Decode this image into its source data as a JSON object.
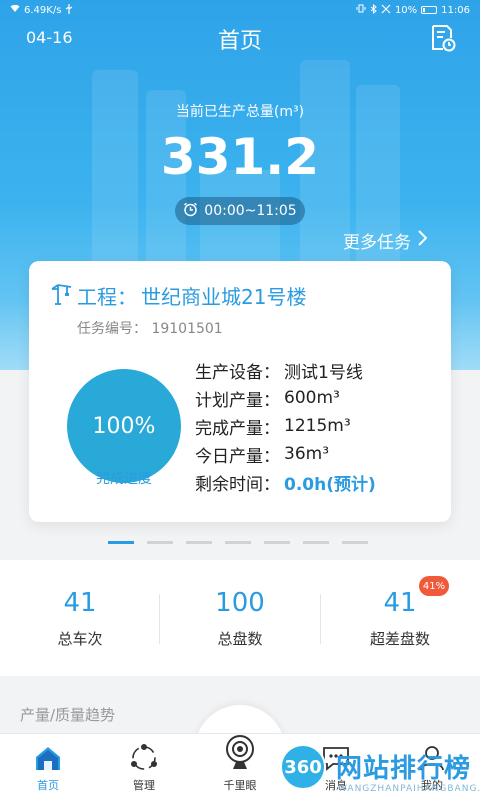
{
  "status_bar": {
    "network_speed": "6.49K/s",
    "battery": "10%",
    "time": "11:06"
  },
  "header": {
    "date": "04-16",
    "title": "首页",
    "doc_icon": "document-clock-icon"
  },
  "production": {
    "total_label": "当前已生产总量(m³)",
    "total_value": "331.2",
    "time_range": "00:00~11:05",
    "more_tasks": "更多任务"
  },
  "task_card": {
    "project_label": "工程：",
    "project_name": "世纪商业城21号楼",
    "task_no_label": "任务编号：",
    "task_no": "19101501",
    "progress": "100%",
    "progress_fraction": 1.0,
    "progress_label": "完成进度",
    "rows": [
      {
        "label": "生产设备：",
        "value": "测试1号线"
      },
      {
        "label": "计划产量：",
        "value": "600m³"
      },
      {
        "label": "完成产量：",
        "value": "1215m³"
      },
      {
        "label": "今日产量：",
        "value": "36m³"
      },
      {
        "label": "剩余时间：",
        "value": "0.0h(预计)"
      }
    ]
  },
  "carousel": {
    "page_count": 7,
    "active_index": 0
  },
  "stats": [
    {
      "value": "41",
      "label": "总车次"
    },
    {
      "value": "100",
      "label": "总盘数"
    },
    {
      "value": "41",
      "label": "超差盘数",
      "badge": "41%"
    }
  ],
  "trend_header": "产量/质量趋势",
  "tabs": [
    {
      "label": "首页",
      "icon": "home-icon"
    },
    {
      "label": "管理",
      "icon": "manage-icon"
    },
    {
      "label": "千里眼",
      "icon": "camera-icon"
    },
    {
      "label": "消息",
      "icon": "message-icon"
    },
    {
      "label": "我的",
      "icon": "user-icon"
    }
  ],
  "watermark": {
    "badge": "360",
    "text": "网站排行榜",
    "sub": "WANGZHANPAIHANGBANG.CN"
  },
  "colors": {
    "accent": "#2a9be0",
    "progress_circle": "#28a9d7",
    "badge": "#f05a3a"
  }
}
